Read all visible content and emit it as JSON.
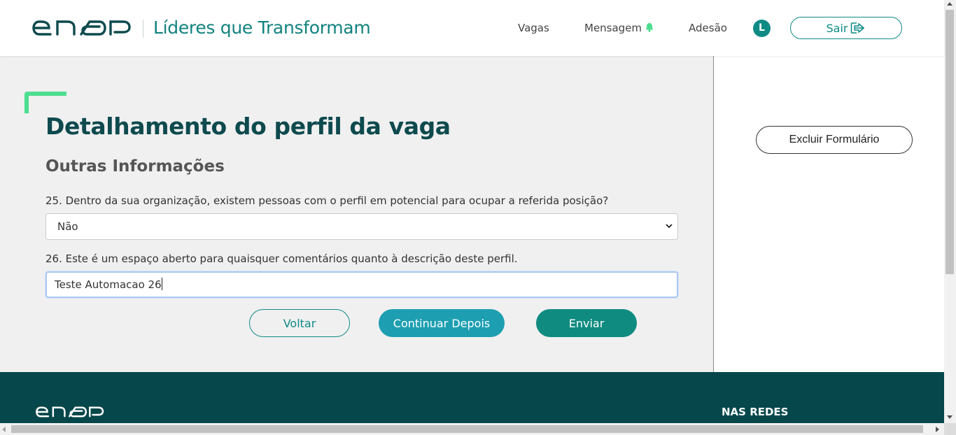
{
  "header": {
    "logo_alt": "enap",
    "app_title": "Líderes que Transformam",
    "nav": {
      "vagas": "Vagas",
      "mensagem": "Mensagem",
      "adesao": "Adesão"
    },
    "avatar_initial": "L",
    "logout_label": "Sair"
  },
  "main": {
    "page_title": "Detalhamento do perfil da vaga",
    "section_title": "Outras Informações",
    "question_25": {
      "label": "25. Dentro da sua organização, existem pessoas com o perfil em potencial para ocupar a referida posição?",
      "selected": "Não"
    },
    "question_26": {
      "label": "26. Este é um espaço aberto para quaisquer comentários quanto à descrição deste perfil.",
      "value": "Teste Automacao 26"
    },
    "buttons": {
      "back": "Voltar",
      "continue_later": "Continuar Depois",
      "submit": "Enviar"
    }
  },
  "sidebar": {
    "delete_form": "Excluir Formulário"
  },
  "footer": {
    "social_heading": "NAS REDES"
  },
  "colors": {
    "primary": "#0f8b86",
    "title": "#0e4a4e",
    "accent_green": "#4cde8f",
    "footer_bg": "#05474b",
    "continue_button": "#1d9fb1"
  },
  "icons": {
    "bell": "bell-icon",
    "logout": "logout-icon",
    "chevron": "chevron-down-icon"
  }
}
